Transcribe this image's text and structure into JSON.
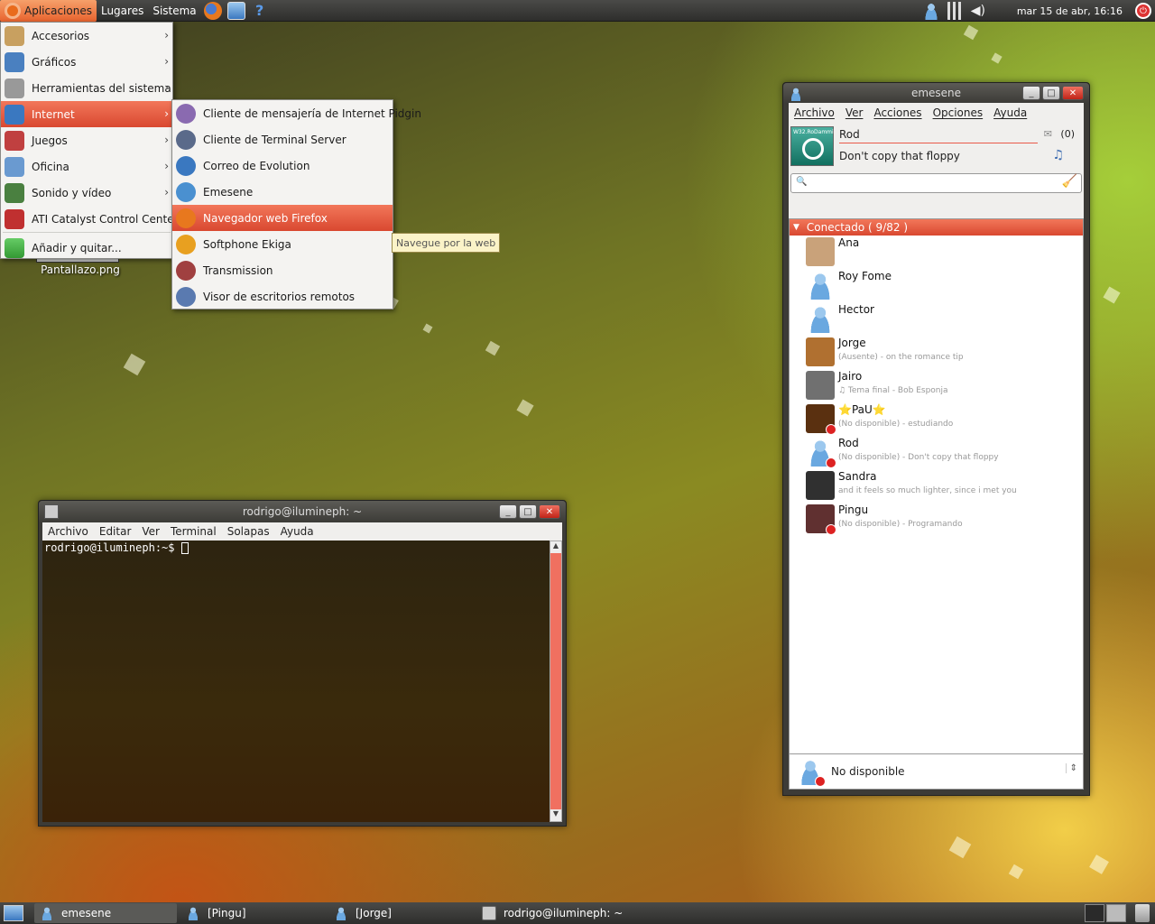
{
  "top_panel": {
    "menus": [
      "Aplicaciones",
      "Lugares",
      "Sistema"
    ],
    "clock": "mar 15 de abr, 16:16"
  },
  "apps_menu": {
    "items": [
      {
        "label": "Accesorios",
        "icon": "accessories-icon"
      },
      {
        "label": "Gráficos",
        "icon": "graphics-icon"
      },
      {
        "label": "Herramientas del sistema",
        "icon": "system-tools-icon"
      },
      {
        "label": "Internet",
        "icon": "internet-icon"
      },
      {
        "label": "Juegos",
        "icon": "games-icon"
      },
      {
        "label": "Oficina",
        "icon": "office-icon"
      },
      {
        "label": "Sonido y vídeo",
        "icon": "sound-video-icon"
      },
      {
        "label": "ATI Catalyst Control Center",
        "icon": "ati-icon"
      }
    ],
    "add_remove": "Añadir y quitar..."
  },
  "internet_menu": {
    "items": [
      {
        "label": "Cliente de mensajería de Internet Pidgin",
        "icon": "pidgin-icon"
      },
      {
        "label": "Cliente de Terminal Server",
        "icon": "terminal-server-icon"
      },
      {
        "label": "Correo de Evolution",
        "icon": "evolution-icon"
      },
      {
        "label": "Emesene",
        "icon": "emesene-icon"
      },
      {
        "label": "Navegador web Firefox",
        "icon": "firefox-icon"
      },
      {
        "label": "Softphone Ekiga",
        "icon": "ekiga-icon"
      },
      {
        "label": "Transmission",
        "icon": "transmission-icon"
      },
      {
        "label": "Visor de escritorios remotos",
        "icon": "remote-desktop-icon"
      }
    ],
    "tooltip": "Navegue por la web"
  },
  "desktop": {
    "file_label": "Pantallazo.png"
  },
  "terminal": {
    "title": "rodrigo@ilumineph: ~",
    "menu": [
      "Archivo",
      "Editar",
      "Ver",
      "Terminal",
      "Solapas",
      "Ayuda"
    ],
    "prompt": "rodrigo@ilumineph:~$ "
  },
  "emesene": {
    "title": "emesene",
    "menu": [
      "Archivo",
      "Ver",
      "Acciones",
      "Opciones",
      "Ayuda"
    ],
    "avatar_caption": "W32.RoDammi",
    "nick": "Rod",
    "personal_message": "Don't copy that floppy",
    "mail_count": "(0)",
    "group": "Conectado ( 9/82 )",
    "contacts": [
      {
        "name": "Ana",
        "message": "",
        "busy": false,
        "color": "#c9a27a"
      },
      {
        "name": "Roy Fome",
        "message": "",
        "busy": false,
        "color": ""
      },
      {
        "name": "Hector",
        "message": "",
        "busy": false,
        "color": ""
      },
      {
        "name": "Jorge",
        "message": "(Ausente) - on the romance tip",
        "busy": false,
        "color": "#b07030"
      },
      {
        "name": "Jairo",
        "message": "♫ Tema final - Bob Esponja",
        "busy": false,
        "color": "#707070"
      },
      {
        "name": "⭐PaU⭐",
        "message": "(No disponible) - estudiando",
        "busy": true,
        "color": "#5a3010"
      },
      {
        "name": "Rod",
        "message": "(No disponible) - Don't copy that floppy",
        "busy": true,
        "color": ""
      },
      {
        "name": "Sandra",
        "message": "and it feels so much lighter, since i met you",
        "busy": false,
        "color": "#303030"
      },
      {
        "name": "Pingu",
        "message": "(No disponible) - Programando",
        "busy": true,
        "color": "#603030"
      }
    ],
    "status": "No disponible"
  },
  "taskbar": {
    "tasks": [
      "emesene",
      "[Pingu]",
      "[Jorge]",
      "rodrigo@ilumineph: ~"
    ]
  },
  "colors": {
    "accent": "#e8632e",
    "highlight": "#d94830"
  }
}
